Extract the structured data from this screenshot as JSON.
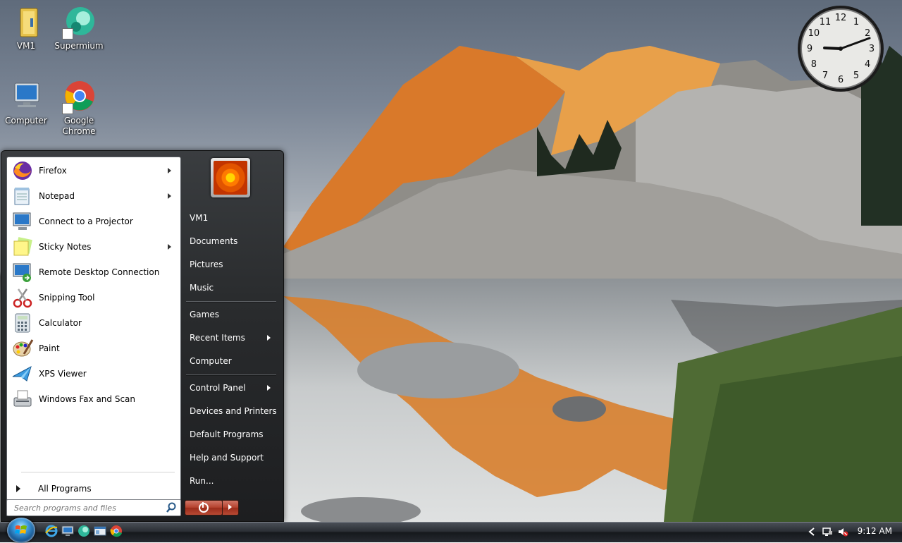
{
  "desktop": {
    "icons": [
      {
        "label": "VM1"
      },
      {
        "label": "Supermium"
      },
      {
        "label": "Computer"
      },
      {
        "label": "Google Chrome"
      }
    ]
  },
  "clock_gadget": {
    "time": "9:12",
    "numbers": [
      "12",
      "1",
      "2",
      "3",
      "4",
      "5",
      "6",
      "7",
      "8",
      "9",
      "10",
      "11"
    ]
  },
  "start_menu": {
    "programs": [
      {
        "label": "Firefox",
        "has_submenu": true,
        "icon": "firefox-icon"
      },
      {
        "label": "Notepad",
        "has_submenu": true,
        "icon": "notepad-icon"
      },
      {
        "label": "Connect to a Projector",
        "has_submenu": false,
        "icon": "projector-icon"
      },
      {
        "label": "Sticky Notes",
        "has_submenu": true,
        "icon": "sticky-notes-icon"
      },
      {
        "label": "Remote Desktop Connection",
        "has_submenu": false,
        "icon": "remote-desktop-icon"
      },
      {
        "label": "Snipping Tool",
        "has_submenu": false,
        "icon": "snipping-tool-icon"
      },
      {
        "label": "Calculator",
        "has_submenu": false,
        "icon": "calculator-icon"
      },
      {
        "label": "Paint",
        "has_submenu": false,
        "icon": "paint-icon"
      },
      {
        "label": "XPS Viewer",
        "has_submenu": false,
        "icon": "xps-viewer-icon"
      },
      {
        "label": "Windows Fax and Scan",
        "has_submenu": false,
        "icon": "fax-scan-icon"
      }
    ],
    "all_programs_label": "All Programs",
    "search_placeholder": "Search programs and files",
    "right_items": [
      {
        "label": "VM1"
      },
      {
        "label": "Documents"
      },
      {
        "label": "Pictures"
      },
      {
        "label": "Music"
      },
      {
        "label": "Games"
      },
      {
        "label": "Recent Items",
        "has_submenu": true
      },
      {
        "label": "Computer"
      },
      {
        "label": "Control Panel",
        "has_submenu": true
      },
      {
        "label": "Devices and Printers"
      },
      {
        "label": "Default Programs"
      },
      {
        "label": "Help and Support"
      },
      {
        "label": "Run..."
      }
    ]
  },
  "taskbar": {
    "time": "9:12 AM",
    "pinned": [
      "internet-explorer-icon",
      "remote-desktop-icon",
      "supermium-icon",
      "explorer-icon",
      "chrome-icon"
    ]
  },
  "colors": {
    "start_menu_bg": "#2a2c2e",
    "taskbar_bg": "#1f2328",
    "accent_blue": "#3a94d6"
  }
}
